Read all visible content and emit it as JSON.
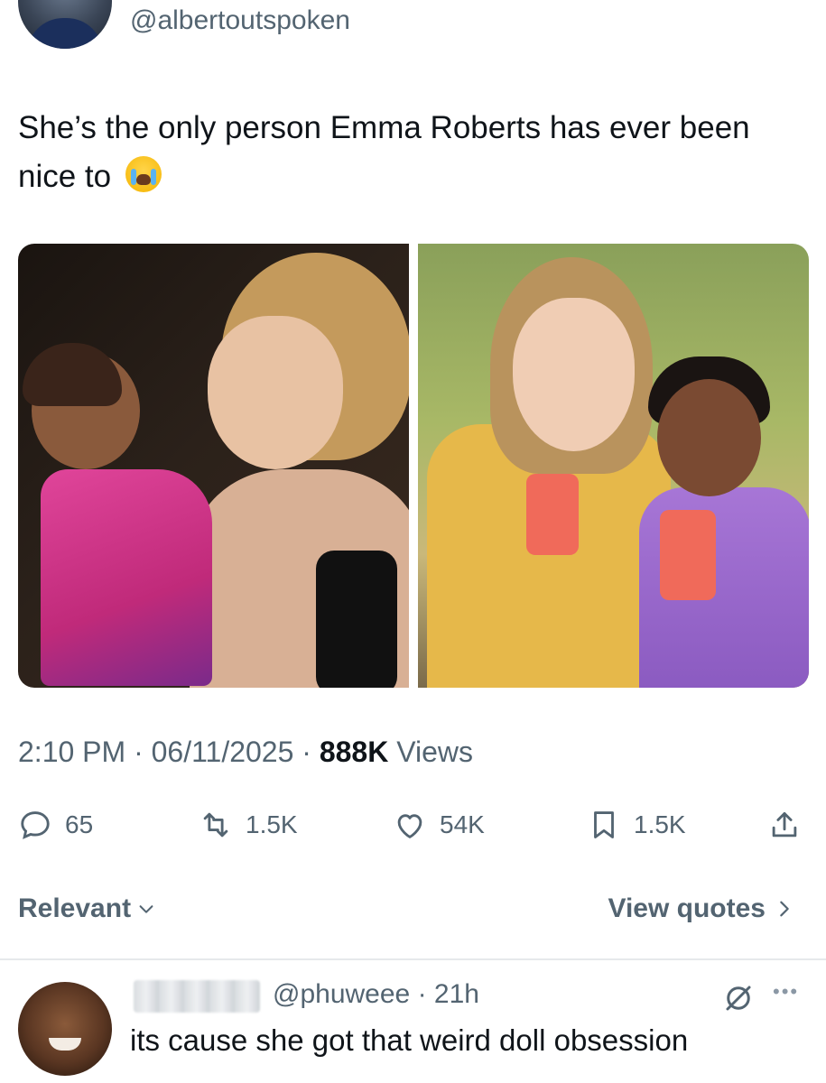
{
  "tweet": {
    "handle": "@albertoutspoken",
    "text": "She’s the only person Emma Roberts has ever been nice to",
    "emoji": "loudly-crying-face",
    "time": "2:10 PM",
    "separator1": " · ",
    "date": "06/11/2025",
    "separator2": " · ",
    "views_count": "888K",
    "views_label": "Views"
  },
  "actions": {
    "reply_count": "65",
    "retweet_count": "1.5K",
    "like_count": "54K",
    "bookmark_count": "1.5K"
  },
  "replies_bar": {
    "sort_label": "Relevant",
    "view_quotes_label": "View quotes"
  },
  "reply": {
    "handle": "@phuweee",
    "separator": " · ",
    "age": "21h",
    "text": "its cause she got that weird doll obsession"
  },
  "colors": {
    "text_primary": "#0f1419",
    "text_secondary": "#536471",
    "divider": "#e6e9eb"
  }
}
